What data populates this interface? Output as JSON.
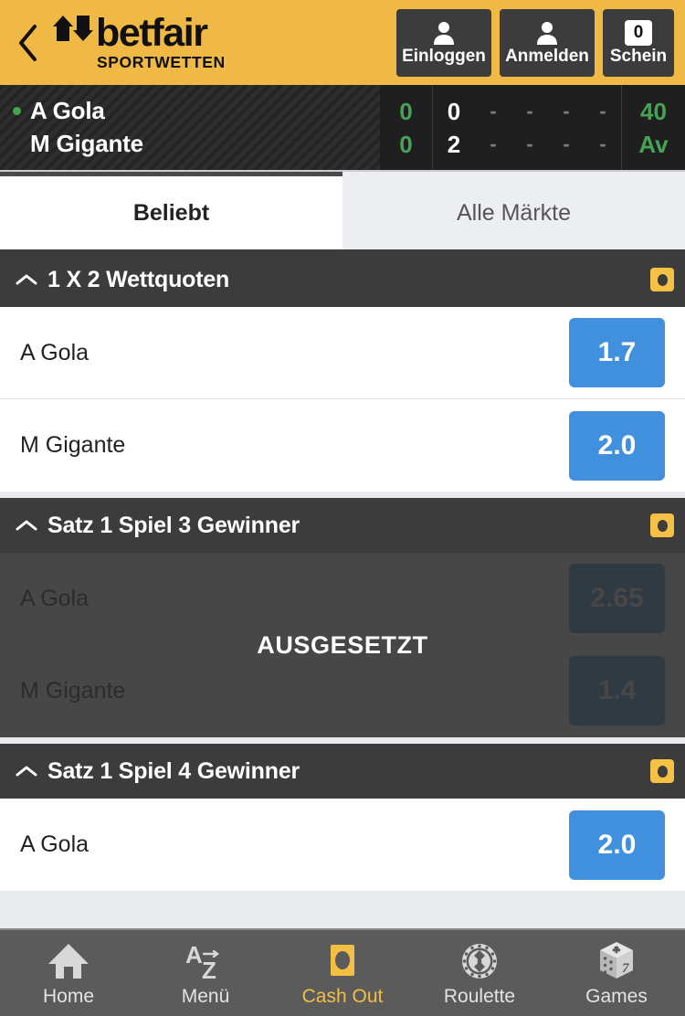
{
  "header": {
    "back_icon": "chevron-left-icon",
    "brand": "betfair",
    "brand_sub": "SPORTWETTEN",
    "buttons": [
      {
        "label": "Einloggen",
        "icon": "person-icon"
      },
      {
        "label": "Anmelden",
        "icon": "person-icon"
      }
    ],
    "betslip": {
      "label": "Schein",
      "count": "0"
    }
  },
  "scoreboard": {
    "players": [
      {
        "name": "A Gola",
        "serving": true,
        "sets": "0",
        "game": "0",
        "set2": "-",
        "set3": "-",
        "set4": "-",
        "set5": "-",
        "points": "40"
      },
      {
        "name": "M Gigante",
        "serving": false,
        "sets": "0",
        "game": "2",
        "set2": "-",
        "set3": "-",
        "set4": "-",
        "set5": "-",
        "points": "Av"
      }
    ]
  },
  "tabs": [
    {
      "label": "Beliebt",
      "active": true
    },
    {
      "label": "Alle Märkte",
      "active": false
    }
  ],
  "markets": [
    {
      "title": "1 X 2 Wettquoten",
      "caret": "chevron-up-icon",
      "cashout_icon": "cashout-icon",
      "suspended": false,
      "selections": [
        {
          "name": "A Gola",
          "odds": "1.7"
        },
        {
          "name": "M Gigante",
          "odds": "2.0"
        }
      ]
    },
    {
      "title": "Satz 1 Spiel 3 Gewinner",
      "caret": "chevron-up-icon",
      "cashout_icon": "cashout-icon",
      "suspended": true,
      "suspended_label": "AUSGESETZT",
      "selections": [
        {
          "name": "A Gola",
          "odds": "2.65"
        },
        {
          "name": "M Gigante",
          "odds": "1.4"
        }
      ]
    },
    {
      "title": "Satz 1 Spiel 4 Gewinner",
      "caret": "chevron-up-icon",
      "cashout_icon": "cashout-icon",
      "suspended": false,
      "selections": [
        {
          "name": "A Gola",
          "odds": "2.0"
        }
      ]
    }
  ],
  "bottom_nav": [
    {
      "label": "Home",
      "icon": "home-icon",
      "active": false
    },
    {
      "label": "Menü",
      "icon": "az-icon",
      "active": false
    },
    {
      "label": "Cash Out",
      "icon": "cashout-icon",
      "active": true
    },
    {
      "label": "Roulette",
      "icon": "roulette-wheel-icon",
      "active": false
    },
    {
      "label": "Games",
      "icon": "dice-icon",
      "active": false
    }
  ],
  "colors": {
    "brand_yellow": "#f0b844",
    "dark": "#3c3c3c",
    "odds_blue": "#4190dd",
    "accent_green": "#46a356",
    "cashout_yellow": "#f5c043",
    "nav_bg": "#5b5b5b"
  }
}
